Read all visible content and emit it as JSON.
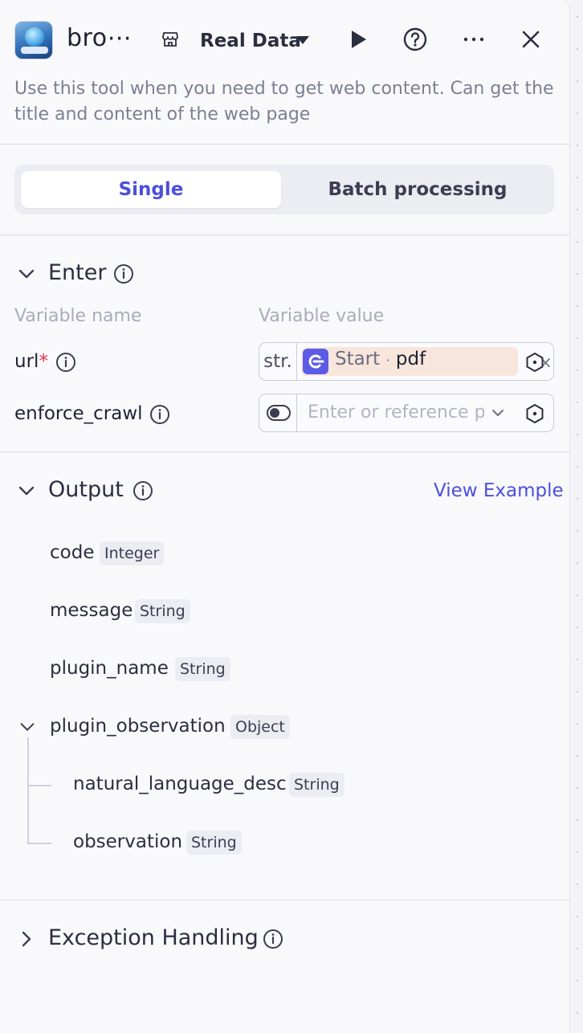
{
  "header": {
    "title": "bro⋯",
    "data_mode": "Real Data",
    "description": "Use this tool when you need to get web content. Can get the title and content of the web page"
  },
  "tabs": [
    {
      "label": "Single",
      "active": true
    },
    {
      "label": "Batch processing",
      "active": false
    }
  ],
  "input_section": {
    "title": "Enter",
    "col_name": "Variable name",
    "col_value": "Variable value",
    "rows": [
      {
        "name": "url",
        "required_mark": "*",
        "type": "str.",
        "ref_node": "Start",
        "ref_dot": "·",
        "ref_var": "pdf",
        "close": "×"
      },
      {
        "name": "enforce_crawl",
        "placeholder": "Enter or reference p"
      }
    ]
  },
  "output_section": {
    "title": "Output",
    "view_example": "View Example",
    "fields": [
      {
        "name": "code",
        "type": "Integer"
      },
      {
        "name": "message",
        "type": "String"
      },
      {
        "name": "plugin_name",
        "type": "String"
      },
      {
        "name": "plugin_observation",
        "type": "Object"
      },
      {
        "name": "natural_language_desc",
        "type": "String"
      },
      {
        "name": "observation",
        "type": "String"
      }
    ]
  },
  "exception_section": {
    "title": "Exception Handling"
  },
  "colors": {
    "accent": "#4c4fdc",
    "ref_chip_bg": "#f8e6dc",
    "required": "#e0314b"
  }
}
